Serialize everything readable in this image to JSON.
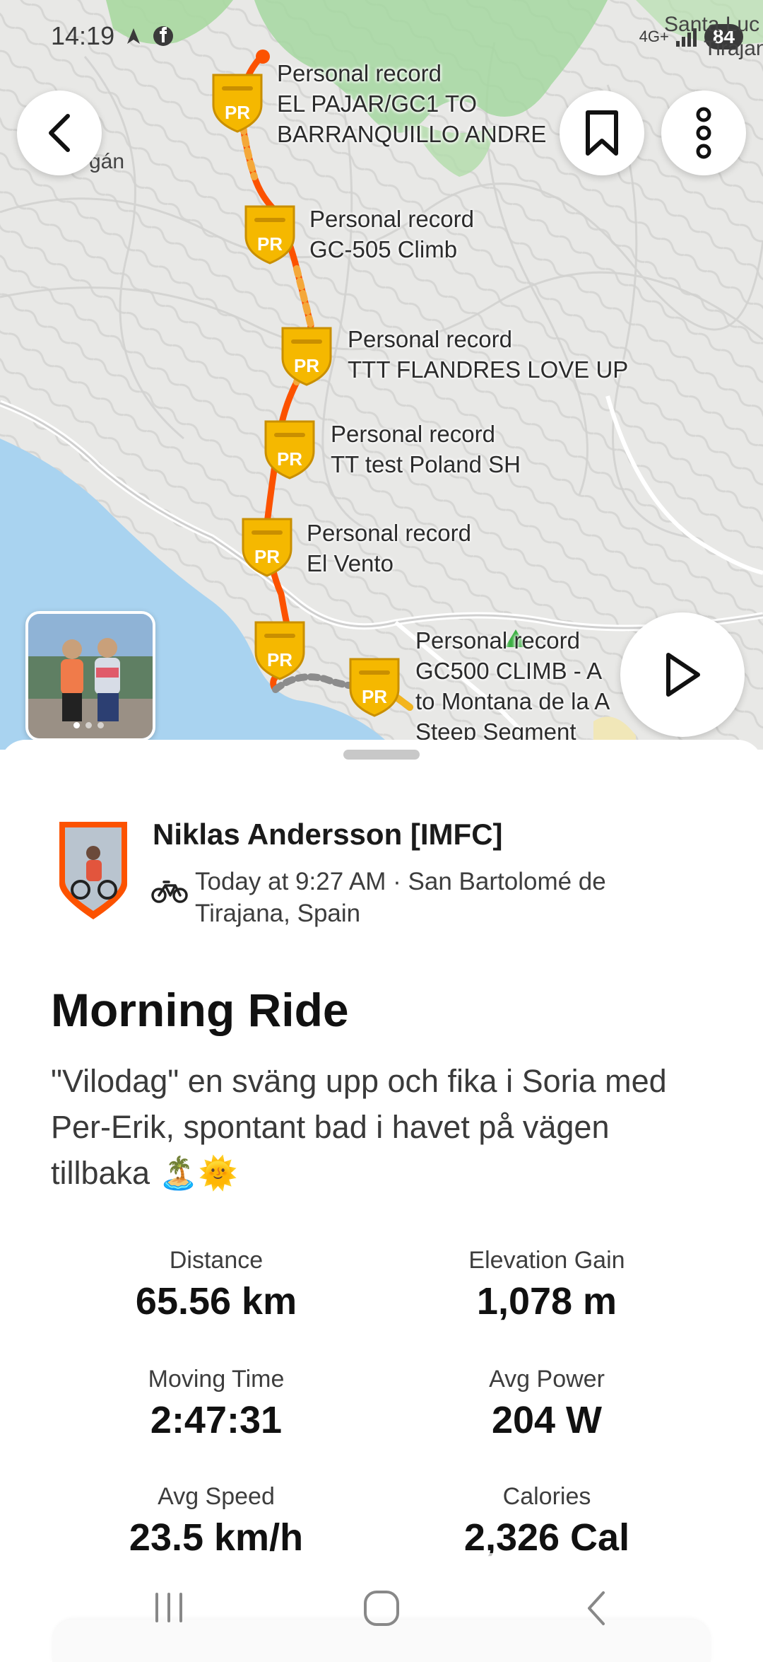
{
  "status_bar": {
    "time": "14:19",
    "network": "4G+",
    "battery": "84"
  },
  "map": {
    "place_names": {
      "top_right_line1": "Santa Luc",
      "top_right_line2": "Tirajan",
      "left_fragment": "gán"
    },
    "personal_records": [
      {
        "title": "Personal record",
        "segment_line1": "EL PAJAR/GC1 TO",
        "segment_line2": "BARRANQUILLO ANDRE",
        "badge": "PR"
      },
      {
        "title": "Personal record",
        "segment_line1": "GC-505 Climb",
        "segment_line2": "",
        "badge": "PR"
      },
      {
        "title": "Personal record",
        "segment_line1": "TTT FLANDRES LOVE UP",
        "segment_line2": "",
        "badge": "PR"
      },
      {
        "title": "Personal record",
        "segment_line1": "TT test Poland SH",
        "segment_line2": "",
        "badge": "PR"
      },
      {
        "title": "Personal record",
        "segment_line1": "El Vento",
        "segment_line2": "",
        "badge": "PR"
      },
      {
        "title": "",
        "segment_line1": "",
        "segment_line2": "",
        "badge": "PR"
      },
      {
        "title": "Personal record",
        "segment_line1": "GC500 CLIMB - A",
        "segment_line2": "to Montana de la A",
        "segment_line3": "Steep Segment",
        "badge": "PR"
      }
    ],
    "buttons": {
      "back": "back-icon",
      "bookmark": "bookmark-icon",
      "more": "more-vertical-icon",
      "play": "play-icon"
    },
    "photo_count": 3
  },
  "activity": {
    "athlete_name": "Niklas Andersson [IMFC]",
    "meta": "Today at 9:27 AM · San Bartolomé de Tirajana, Spain",
    "sport_icon": "bike-icon",
    "title": "Morning Ride",
    "description": "\"Vilodag\" en sväng upp och fika i Soria med Per-Erik, spontant bad i havet på vägen tillbaka 🏝️🌞",
    "stats": [
      {
        "label": "Distance",
        "value": "65.56 km"
      },
      {
        "label": "Elevation Gain",
        "value": "1,078 m"
      },
      {
        "label": "Moving Time",
        "value": "2:47:31"
      },
      {
        "label": "Avg Power",
        "value": "204 W"
      },
      {
        "label": "Avg Speed",
        "value": "23.5 km/h"
      },
      {
        "label": "Calories",
        "value": "2,326 Cal"
      }
    ]
  },
  "colors": {
    "route_orange": "#fc5200",
    "pr_gold": "#f5b800",
    "water": "#a9d3f0",
    "green": "#9fd39a"
  }
}
